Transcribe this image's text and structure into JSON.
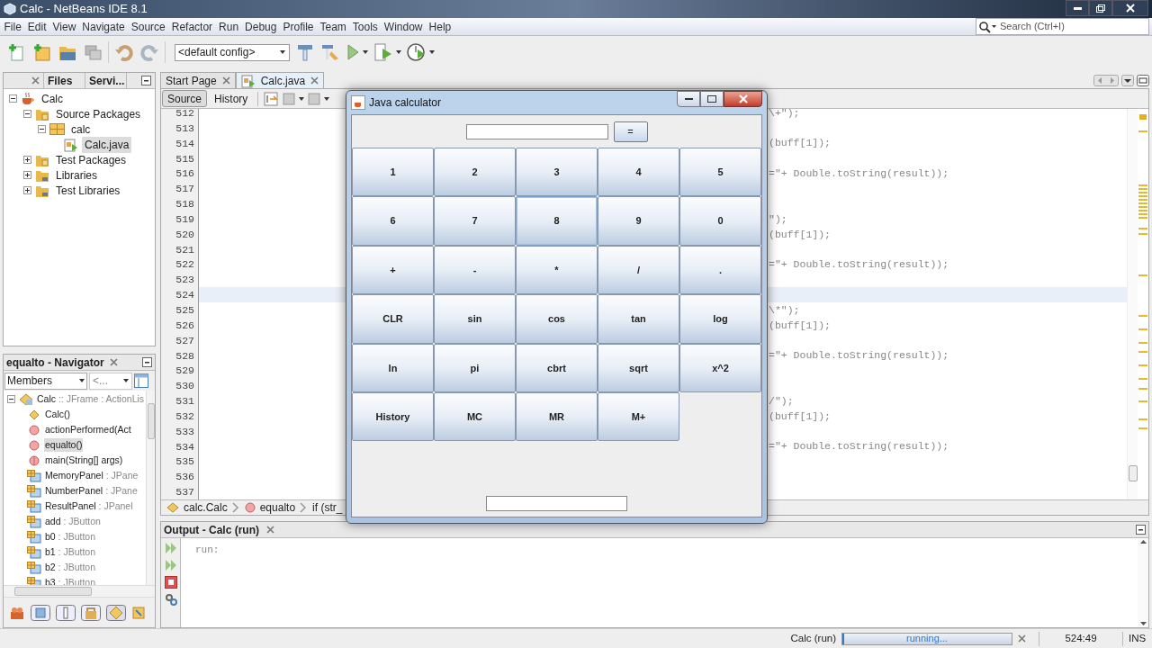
{
  "window": {
    "title": "Calc - NetBeans IDE 8.1"
  },
  "menu": [
    "File",
    "Edit",
    "View",
    "Navigate",
    "Source",
    "Refactor",
    "Run",
    "Debug",
    "Profile",
    "Team",
    "Tools",
    "Window",
    "Help"
  ],
  "search": {
    "placeholder": "Search (Ctrl+I)"
  },
  "toolbar": {
    "config": "<default config>"
  },
  "projects": {
    "tabs": [
      "Files",
      "Servi..."
    ],
    "tree": [
      {
        "label": "Calc",
        "kind": "project",
        "expanded": true,
        "selected": false,
        "children": [
          {
            "label": "Source Packages",
            "kind": "source-folder",
            "expanded": true,
            "selected": false,
            "children": [
              {
                "label": "calc",
                "kind": "package",
                "expanded": true,
                "selected": false,
                "children": [
                  {
                    "label": "Calc.java",
                    "kind": "java-file",
                    "selected": true
                  }
                ]
              }
            ]
          },
          {
            "label": "Test Packages",
            "kind": "source-folder",
            "expanded": false,
            "selected": false
          },
          {
            "label": "Libraries",
            "kind": "library",
            "expanded": false,
            "selected": false
          },
          {
            "label": "Test Libraries",
            "kind": "library",
            "expanded": false,
            "selected": false
          }
        ]
      }
    ]
  },
  "navigator": {
    "title": "equalto - Navigator",
    "filter": "Members",
    "scope": "<...",
    "root": {
      "name": "Calc",
      "type": ":: JFrame : ActionLis",
      "expanded": true
    },
    "members": [
      {
        "name": "Calc()",
        "kind": "constructor",
        "selected": false
      },
      {
        "name": "actionPerformed(Act",
        "kind": "method",
        "selected": false
      },
      {
        "name": "equalto()",
        "kind": "method",
        "selected": true
      },
      {
        "name": "main(String[] args)",
        "kind": "static-method",
        "selected": false
      },
      {
        "name": "MemoryPanel",
        "type": ": JPane",
        "kind": "field",
        "selected": false
      },
      {
        "name": "NumberPanel",
        "type": ": JPane",
        "kind": "field",
        "selected": false
      },
      {
        "name": "ResultPanel",
        "type": ": JPanel",
        "kind": "field",
        "selected": false
      },
      {
        "name": "add",
        "type": ": JButton",
        "kind": "field",
        "selected": false
      },
      {
        "name": "b0",
        "type": ": JButton",
        "kind": "field",
        "selected": false
      },
      {
        "name": "b1",
        "type": ": JButton",
        "kind": "field",
        "selected": false
      },
      {
        "name": "b2",
        "type": ": JButton",
        "kind": "field",
        "selected": false
      },
      {
        "name": "b3",
        "type": ": JButton",
        "kind": "field",
        "selected": false
      }
    ]
  },
  "editor": {
    "tabs": [
      {
        "label": "Start Page",
        "selected": false
      },
      {
        "label": "Calc.java",
        "selected": true
      }
    ],
    "views": [
      {
        "label": "Source",
        "selected": true
      },
      {
        "label": "History",
        "selected": false
      }
    ],
    "lines": [
      {
        "number": "512",
        "code": "\\+\");",
        "current": false
      },
      {
        "number": "513",
        "current": false
      },
      {
        "number": "514",
        "code": "(buff[1]);",
        "current": false
      },
      {
        "number": "515",
        "current": false
      },
      {
        "number": "516",
        "code": "=\"+ Double.toString(result));",
        "current": false
      },
      {
        "number": "517",
        "current": false
      },
      {
        "number": "518",
        "current": false
      },
      {
        "number": "519",
        "code": "\");",
        "current": false
      },
      {
        "number": "520",
        "code": "(buff[1]);",
        "current": false
      },
      {
        "number": "521",
        "current": false
      },
      {
        "number": "522",
        "code": "=\"+ Double.toString(result));",
        "current": false
      },
      {
        "number": "523",
        "current": false
      },
      {
        "number": "524",
        "current": true
      },
      {
        "number": "525",
        "code": "\\*\");",
        "current": false
      },
      {
        "number": "526",
        "code": "(buff[1]);",
        "current": false
      },
      {
        "number": "527",
        "current": false
      },
      {
        "number": "528",
        "code": "=\"+ Double.toString(result));",
        "current": false
      },
      {
        "number": "529",
        "current": false
      },
      {
        "number": "530",
        "current": false
      },
      {
        "number": "531",
        "code": "/\");",
        "current": false
      },
      {
        "number": "532",
        "code": "(buff[1]);",
        "current": false
      },
      {
        "number": "533",
        "current": false
      },
      {
        "number": "534",
        "code": "=\"+ Double.toString(result));",
        "current": false
      },
      {
        "number": "535",
        "current": false
      },
      {
        "number": "536",
        "current": false
      },
      {
        "number": "537",
        "current": false
      }
    ],
    "breadcrumb": [
      {
        "label": "calc.Calc",
        "kind": "class"
      },
      {
        "label": "equalto",
        "kind": "method"
      },
      {
        "label": "if (str_",
        "kind": "statement"
      }
    ]
  },
  "output": {
    "title": "Output - Calc (run)",
    "text": "run:"
  },
  "calculator": {
    "title": "Java calculator",
    "equals": "=",
    "keys": [
      {
        "label": "1",
        "focused": false
      },
      {
        "label": "2",
        "focused": false
      },
      {
        "label": "3",
        "focused": false
      },
      {
        "label": "4",
        "focused": false
      },
      {
        "label": "5",
        "focused": false
      },
      {
        "label": "6",
        "focused": false
      },
      {
        "label": "7",
        "focused": false
      },
      {
        "label": "8",
        "focused": true
      },
      {
        "label": "9",
        "focused": false
      },
      {
        "label": "0",
        "focused": false
      },
      {
        "label": "+",
        "focused": false
      },
      {
        "label": "-",
        "focused": false
      },
      {
        "label": "*",
        "focused": false
      },
      {
        "label": "/",
        "focused": false
      },
      {
        "label": ".",
        "focused": false
      },
      {
        "label": "CLR",
        "focused": false
      },
      {
        "label": "sin",
        "focused": false
      },
      {
        "label": "cos",
        "focused": false
      },
      {
        "label": "tan",
        "focused": false
      },
      {
        "label": "log",
        "focused": false
      },
      {
        "label": "ln",
        "focused": false
      },
      {
        "label": "pi",
        "focused": false
      },
      {
        "label": "cbrt",
        "focused": false
      },
      {
        "label": "sqrt",
        "focused": false
      },
      {
        "label": "x^2",
        "focused": false
      },
      {
        "label": "History",
        "focused": false
      },
      {
        "label": "MC",
        "focused": false
      },
      {
        "label": "MR",
        "focused": false
      },
      {
        "label": "M+",
        "focused": false
      }
    ]
  },
  "status_bar": {
    "task": "Calc (run)",
    "progress": "running...",
    "level": 1,
    "position": "524:49",
    "mode": "INS"
  }
}
